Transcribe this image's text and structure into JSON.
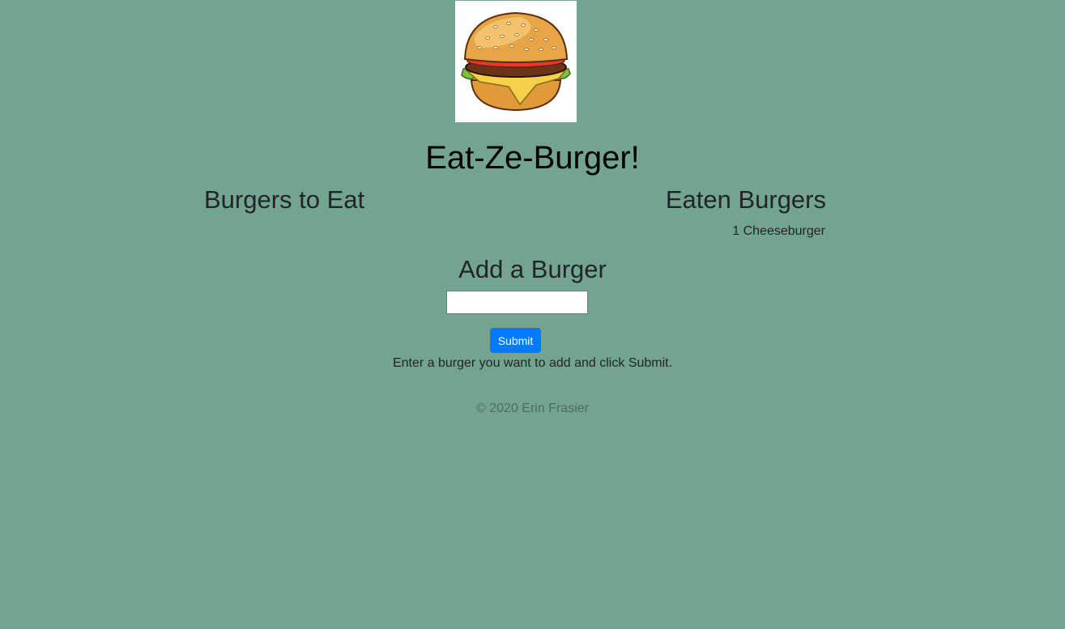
{
  "header": {
    "logo_icon": "burger-icon",
    "title": "Eat-Ze-Burger!"
  },
  "to_eat": {
    "heading": "Burgers to Eat",
    "items": []
  },
  "eaten": {
    "heading": "Eaten Burgers",
    "items": [
      "1 Cheeseburger"
    ]
  },
  "add_form": {
    "heading": "Add a Burger",
    "input_value": "",
    "submit_label": "Submit",
    "hint": "Enter a burger you want to add and click Submit."
  },
  "footer": {
    "copyright": "© 2020 Erin Frasier"
  },
  "colors": {
    "background": "#73a48f",
    "button": "#007bff"
  }
}
